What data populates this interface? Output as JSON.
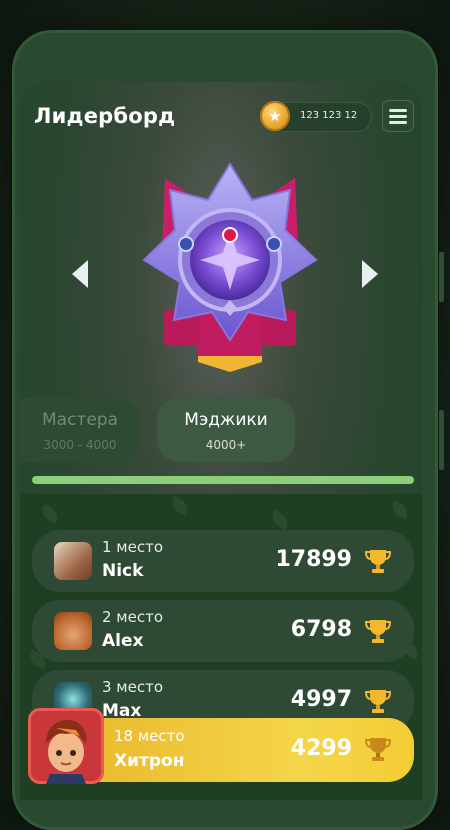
{
  "header": {
    "title": "Лидерборд",
    "coins": "123 123 12"
  },
  "league": {
    "tabs": [
      {
        "name": "Мастера",
        "range": "3000 - 4000"
      },
      {
        "name": "Мэджики",
        "range": "4000+"
      }
    ],
    "progress": 1.0
  },
  "leaderboard": [
    {
      "place": "1 место",
      "name": "Nick",
      "score": "17899"
    },
    {
      "place": "2 место",
      "name": "Alex",
      "score": "6798"
    },
    {
      "place": "3 место",
      "name": "Max",
      "score": "4997"
    }
  ],
  "current_user": {
    "place": "18 место",
    "name": "Хитрон",
    "score": "4299"
  },
  "icons": {
    "coin": "star-coin-icon",
    "menu": "hamburger-icon",
    "trophy": "trophy-icon",
    "arrows": [
      "chevron-left-icon",
      "chevron-right-icon"
    ]
  },
  "colors": {
    "accent_progress": "#8dcf79",
    "highlight_row": "#f4d54a",
    "row_bg": "#2f4a34"
  }
}
